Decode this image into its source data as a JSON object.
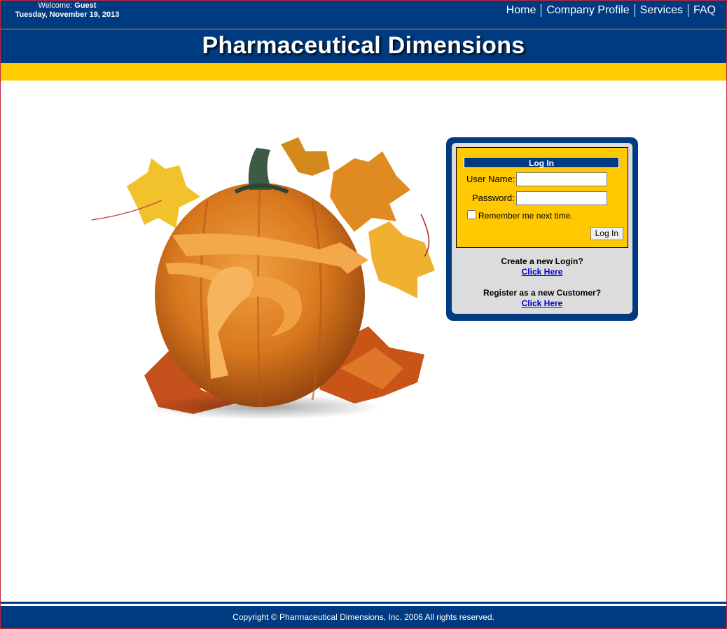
{
  "header": {
    "welcome_prefix": "Welcome:",
    "welcome_user": "Guest",
    "date": "Tuesday, November 19, 2013",
    "nav": [
      "Home",
      "Company Profile",
      "Services",
      "FAQ"
    ]
  },
  "site_title": "Pharmaceutical Dimensions",
  "login": {
    "heading": "Log In",
    "username_label": "User Name:",
    "username_value": "",
    "password_label": "Password:",
    "password_value": "",
    "remember_label": "Remember me next time.",
    "submit_label": "Log In"
  },
  "links": {
    "create_question": "Create a new Login?",
    "create_link": "Click Here",
    "register_question": "Register as a new Customer?",
    "register_link": "Click Here"
  },
  "footer": {
    "copyright": "Copyright © Pharmaceutical Dimensions, Inc. 2006 All rights reserved."
  },
  "colors": {
    "navy": "#003a80",
    "gold": "#ffcc00",
    "link": "#0000cc"
  },
  "hero": {
    "icon": "pumpkin-illustration"
  }
}
